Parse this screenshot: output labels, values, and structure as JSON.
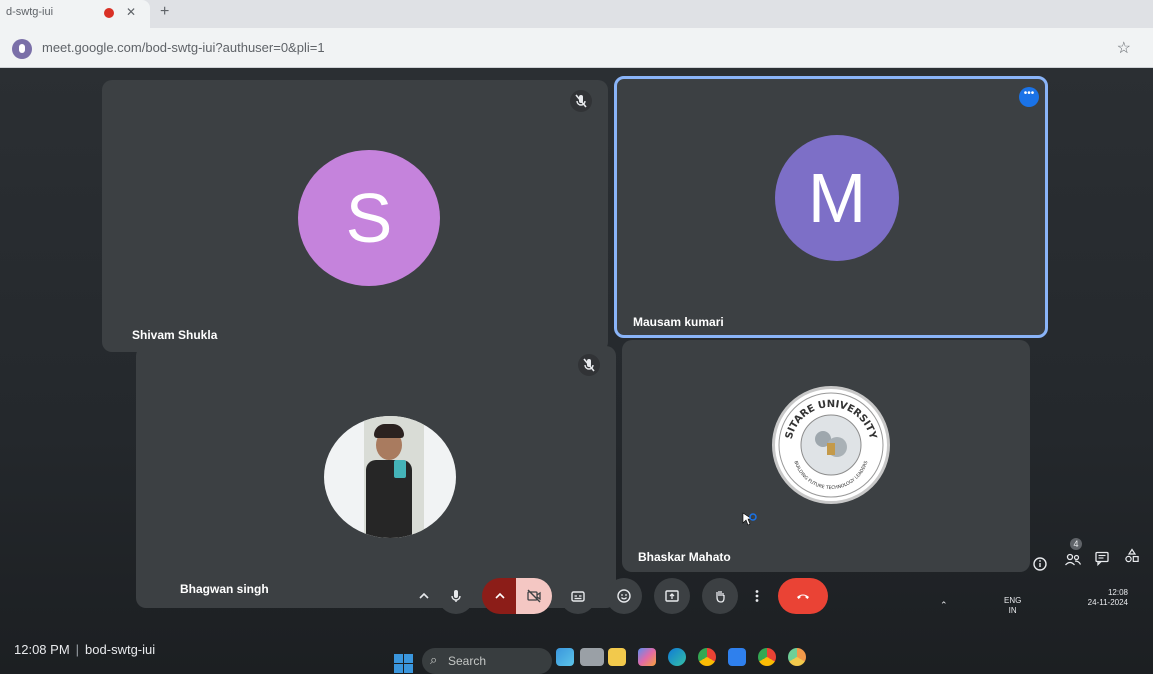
{
  "browser": {
    "tab_title": "d-swtg-iui",
    "tab_close": "✕",
    "new_tab": "+",
    "url": "meet.google.com/bod-swtg-iui?authuser=0&pli=1",
    "bookmark_icon": "star-icon"
  },
  "participants": [
    {
      "name": "Shivam Shukla",
      "initial": "S",
      "avatar_color": "#c583dc",
      "muted": true
    },
    {
      "name": "Mausam kumari",
      "initial": "M",
      "avatar_color": "#7d6fc7",
      "muted": false,
      "active_speaker": true
    },
    {
      "name": "Bhagwan singh",
      "initial": "",
      "avatar_type": "photo",
      "muted": true
    },
    {
      "name": "Bhaskar Mahato",
      "initial": "",
      "avatar_type": "logo",
      "logo_text": "SITARE UNIVERSITY",
      "logo_subtext": "BUILDING FUTURE TECHNOLOGY LEADERS",
      "muted": false
    }
  ],
  "meeting": {
    "time": "12:08 PM",
    "separator": "|",
    "code": "bod-swtg-iui"
  },
  "controls": [
    {
      "name": "more-audio-options",
      "icon": "chevron-up-icon"
    },
    {
      "name": "microphone",
      "icon": "microphone-icon"
    },
    {
      "name": "more-video-options",
      "icon": "chevron-up-icon"
    },
    {
      "name": "camera-off",
      "icon": "camera-off-icon"
    },
    {
      "name": "captions",
      "icon": "captions-icon"
    },
    {
      "name": "reactions",
      "icon": "emoji-icon"
    },
    {
      "name": "present",
      "icon": "present-icon"
    },
    {
      "name": "raise-hand",
      "icon": "hand-icon"
    },
    {
      "name": "more-options",
      "icon": "more-vert-icon"
    },
    {
      "name": "leave-call",
      "icon": "phone-hangup-icon"
    }
  ],
  "side_panel": {
    "people_count": "4",
    "icons": [
      "info-icon",
      "people-icon",
      "chat-icon",
      "activities-icon"
    ]
  },
  "taskbar": {
    "search_label": "Search",
    "apps": [
      "widgets-icon",
      "file-explorer-icon",
      "folder-icon",
      "copilot-icon",
      "edge-icon",
      "chrome-icon",
      "vscode-icon",
      "chrome-beta-icon",
      "chrome-canary-icon"
    ]
  },
  "tray": {
    "lang_top": "ENG",
    "lang_bottom": "IN",
    "clock_time": "12:08",
    "clock_date": "24-11-2024"
  },
  "colors": {
    "active_border": "#8ab4f8",
    "leave_red": "#ea4335",
    "tile_bg": "#3c4043"
  }
}
